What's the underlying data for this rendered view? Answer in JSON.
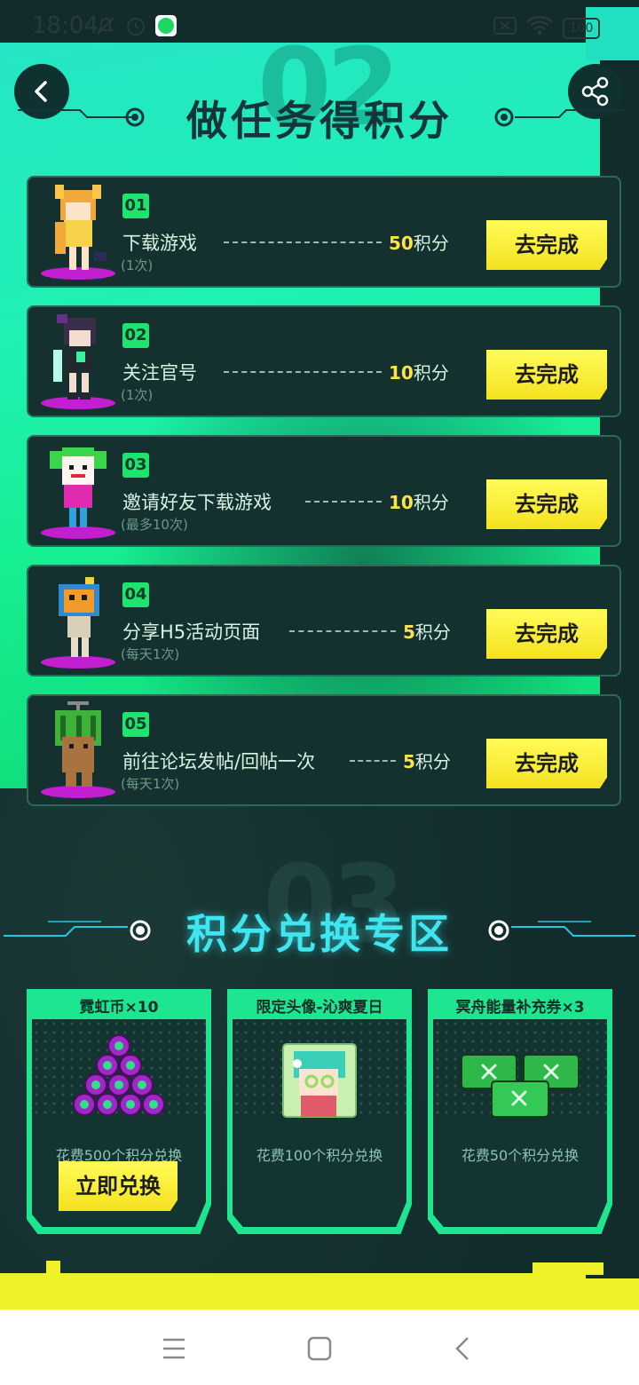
{
  "status_bar": {
    "time": "18:04",
    "battery": "100"
  },
  "header": {
    "tasks_title": "做任务得积分",
    "exchange_title": "积分兑换专区",
    "ghost_tasks": "02",
    "ghost_exchange": "03"
  },
  "tasks": [
    {
      "num": "01",
      "name": "下载游戏",
      "limit": "(1次)",
      "points": "50",
      "unit": "积分",
      "button": "去完成"
    },
    {
      "num": "02",
      "name": "关注官号",
      "limit": "(1次)",
      "points": "10",
      "unit": "积分",
      "button": "去完成"
    },
    {
      "num": "03",
      "name": "邀请好友下载游戏",
      "limit": "(最多10次)",
      "points": "10",
      "unit": "积分",
      "button": "去完成"
    },
    {
      "num": "04",
      "name": "分享H5活动页面",
      "limit": "(每天1次)",
      "points": "5",
      "unit": "积分",
      "button": "去完成"
    },
    {
      "num": "05",
      "name": "前往论坛发帖/回帖一次",
      "limit": "(每天1次)",
      "points": "5",
      "unit": "积分",
      "button": "去完成"
    }
  ],
  "exchange": [
    {
      "title": "霓虹币×10",
      "cost": "花费500个积分兑换",
      "button": "立即兑换"
    },
    {
      "title": "限定头像-沁爽夏日",
      "cost": "花费100个积分兑换"
    },
    {
      "title": "冥舟能量补充券×3",
      "cost": "花费50个积分兑换"
    }
  ],
  "colors": {
    "neon_green": "#1ff0b4",
    "button_yellow": "#fffb58",
    "points_yellow": "#ffe14a",
    "card_bg": "#14302f"
  },
  "icons": [
    "back-icon",
    "share-icon",
    "menu-icon",
    "home-icon",
    "nav-back-icon"
  ]
}
